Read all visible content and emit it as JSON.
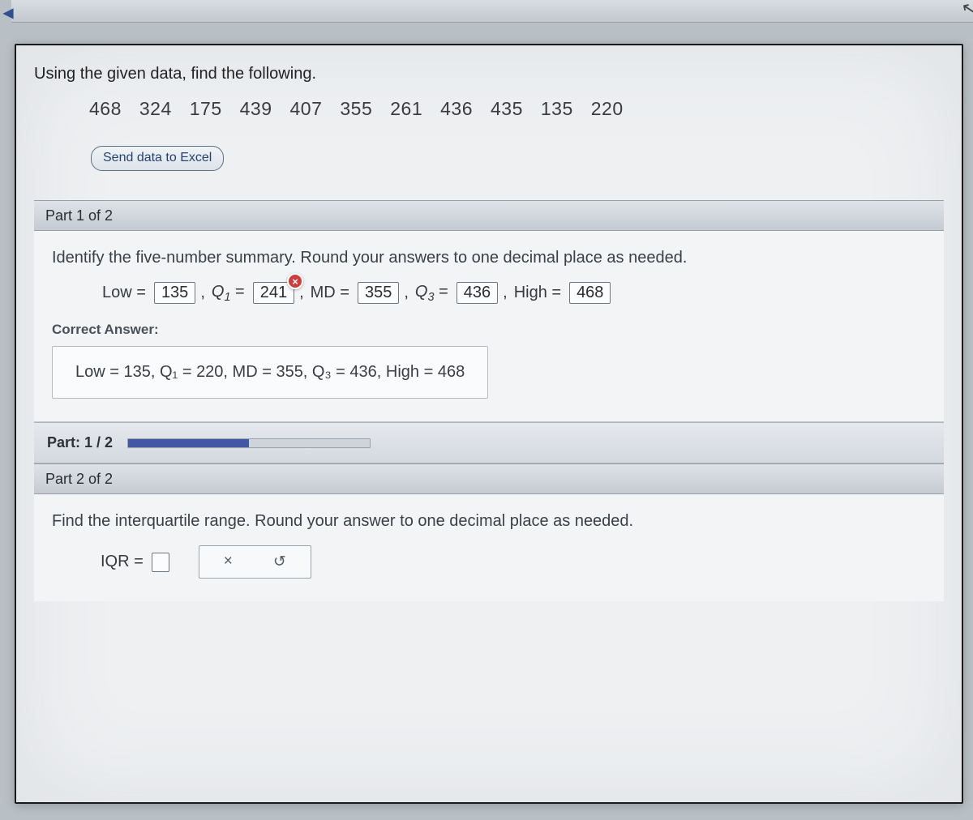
{
  "prompt": "Using the given data, find the following.",
  "data_values": [
    "468",
    "324",
    "175",
    "439",
    "407",
    "355",
    "261",
    "436",
    "435",
    "135",
    "220"
  ],
  "send_button_label": "Send data to Excel",
  "part1": {
    "header": "Part 1 of 2",
    "instruction": "Identify the five-number summary. Round your answers to one decimal place as needed.",
    "labels": {
      "low": "Low =",
      "q1_a": "Q",
      "q1_sub": "1",
      "eq": " = ",
      "md": "MD =",
      "q3_a": "Q",
      "q3_sub": "3",
      "high": "High ="
    },
    "entered": {
      "low": "135",
      "q1": "241",
      "md": "355",
      "q3": "436",
      "high": "468"
    },
    "wrong_badge": "×",
    "correct_label": "Correct Answer:",
    "correct_text": "Low = 135, Q₁ = 220, MD = 355, Q₃ = 436, High = 468"
  },
  "progress": {
    "label": "Part: 1 / 2",
    "percent": 50
  },
  "part2": {
    "header": "Part 2 of 2",
    "instruction": "Find the interquartile range. Round your answer to one decimal place as needed.",
    "iqr_label": "IQR =",
    "clear_icon": "×",
    "reset_icon": "↺"
  }
}
